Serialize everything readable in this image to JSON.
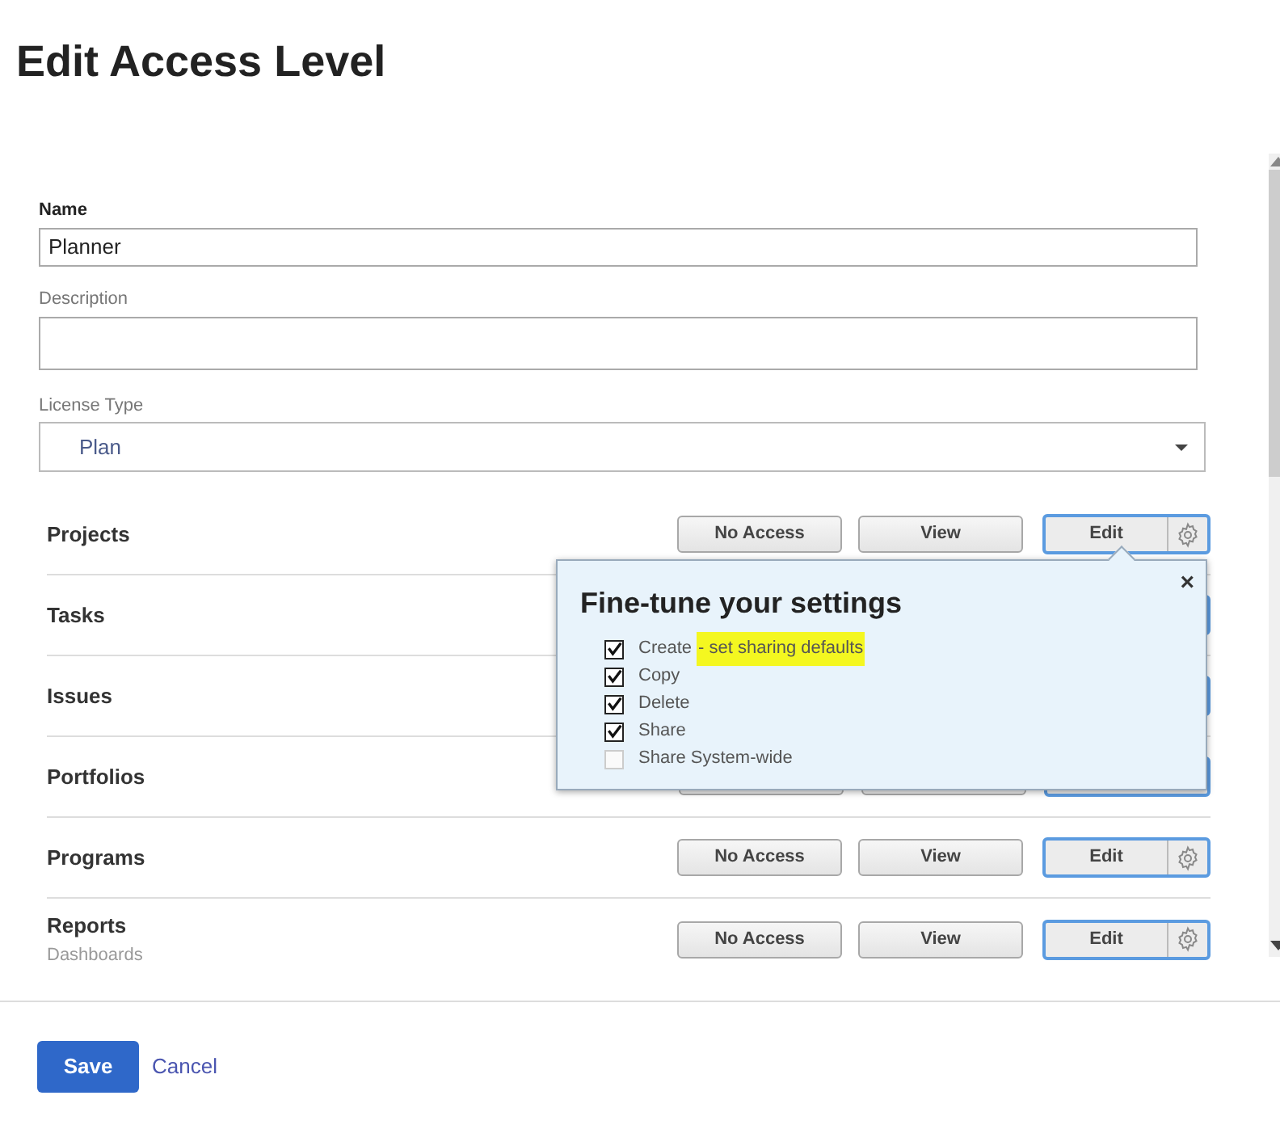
{
  "title": "Edit Access Level",
  "fields": [
    {
      "kind": "text",
      "label": "Name",
      "value": "Planner",
      "bold": true
    },
    {
      "kind": "text",
      "label": "Description",
      "bold": false
    },
    {
      "kind": "select",
      "label": "License Type",
      "value": "Plan",
      "bold": false
    }
  ],
  "rows": [
    {
      "name": "Projects",
      "access": [
        {
          "label": "No Access",
          "selected": false
        },
        {
          "label": "View",
          "selected": false
        },
        {
          "label": "Edit",
          "selected": true
        }
      ]
    },
    {
      "name": "Tasks"
    },
    {
      "name": "Issues"
    },
    {
      "name": "Portfolios"
    },
    {
      "name": "Programs",
      "access": [
        {
          "label": "No Access",
          "selected": false
        },
        {
          "label": "View",
          "selected": false
        },
        {
          "label": "Edit",
          "selected": true
        }
      ]
    },
    {
      "name": "Reports",
      "sub": "Dashboards",
      "access": [
        {
          "label": "No Access",
          "selected": false
        },
        {
          "label": "View",
          "selected": false
        },
        {
          "label": "Edit",
          "selected": true
        }
      ]
    }
  ],
  "popover": {
    "title": "Fine-tune your settings",
    "close": "×",
    "options": [
      {
        "label": "Create",
        "note": "- set sharing defaults",
        "highlighted": true,
        "checked": true
      },
      {
        "label": "Copy",
        "checked": true
      },
      {
        "label": "Delete",
        "checked": true
      },
      {
        "label": "Share",
        "checked": true
      },
      {
        "label": "Share System-wide",
        "checked": false
      }
    ]
  },
  "buttons": {
    "save": "Save",
    "cancel": "Cancel"
  }
}
